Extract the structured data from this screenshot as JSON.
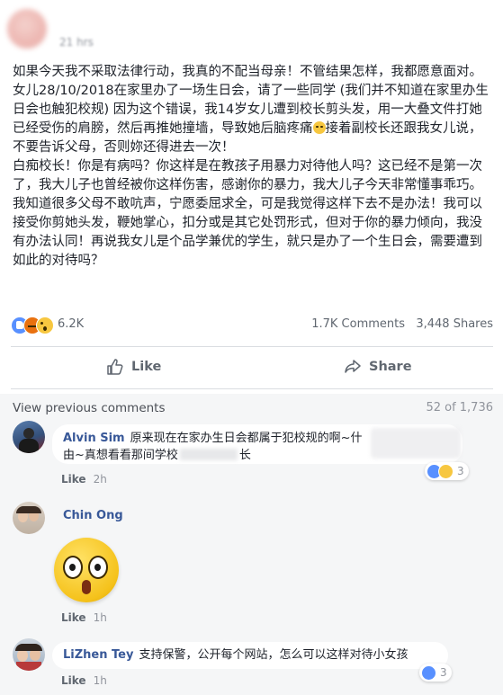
{
  "post": {
    "time": "21 hrs",
    "paragraphs": [
      "如果今天我不采取法律行动，我真的不配当母亲！不管结果怎样，我都愿意面对。",
      "女儿28/10/2018在家里办了一场生日会，请了一些同学 (我们并不知道在家里办生日会也触犯校规) 因为这个错误，我14岁女儿遭到校长剪头发，用一大叠文件打她已经受伤的肩膀，然后再推她撞墙，导致她后脑疼痛",
      "接着副校长还跟我女儿说，不要告诉父母，否则妳还得进去一次！",
      "白痴校长！你是有病吗？你这样是在教孩子用暴力对待他人吗？这已经不是第一次了，我大儿子也曾经被你这样伤害，感谢你的暴力，我大儿子今天非常懂事乖巧。",
      "我知道很多父母不敢吭声，宁愿委屈求全，可是我觉得这样下去不是办法！我可以接受你剪她头发，鞭她掌心，扣分或是其它处罚形式，但对于你的暴力倾向，我没有办法认同！再说我女儿是个品学兼优的学生，就只是办了一个生日会，需要遭到如此的对待吗？"
    ],
    "reaction_count": "6.2K",
    "comments_count": "1.7K Comments",
    "shares_count": "3,448 Shares",
    "like_label": "Like",
    "share_label": "Share"
  },
  "comments_section": {
    "view_previous": "View previous comments",
    "page_count": "52 of 1,736",
    "comments": [
      {
        "name": "Alvin Sim",
        "text": "原来现在在家办生日会都属于犯校规的啊~什",
        "text2": "由~真想看看那间学校",
        "text2_tail": "长",
        "like": "Like",
        "time": "2h",
        "reactions": "3"
      },
      {
        "name": "Chin Ong",
        "like": "Like",
        "time": "1h"
      },
      {
        "name": "LiZhen Tey",
        "text": "支持保警，公开每个网站，怎么可以这样对待小女孩",
        "like": "Like",
        "time": "1h",
        "reactions": "3"
      }
    ]
  },
  "colors": {
    "link": "#385898",
    "like_blue": "#5890ff",
    "angry": "#e9710f",
    "wow": "#f7c740"
  },
  "icons": [
    "like-outline-icon",
    "share-arrow-icon",
    "like-reaction-icon",
    "angry-reaction-icon",
    "wow-reaction-icon",
    "surprised-sticker-icon"
  ]
}
